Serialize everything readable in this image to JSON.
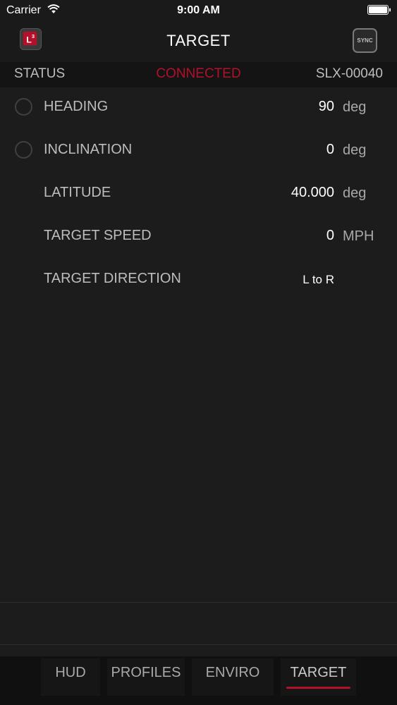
{
  "status_bar": {
    "carrier": "Carrier",
    "time": "9:00 AM",
    "wifi_icon": "wifi-icon",
    "battery_icon": "battery-icon"
  },
  "nav": {
    "title": "TARGET",
    "logo_icon": "l3-logo-icon",
    "sync_label": "SYNC"
  },
  "status": {
    "label": "STATUS",
    "value": "CONNECTED",
    "value_color": "#b3102a",
    "device_id": "SLX-00040"
  },
  "rows": [
    {
      "label": "HEADING",
      "value": "90",
      "unit": "deg",
      "has_radio": true
    },
    {
      "label": "INCLINATION",
      "value": "0",
      "unit": "deg",
      "has_radio": true
    },
    {
      "label": "LATITUDE",
      "value": "40.000",
      "unit": "deg",
      "has_radio": false
    },
    {
      "label": "TARGET SPEED",
      "value": "0",
      "unit": "MPH",
      "has_radio": false
    },
    {
      "label": "TARGET DIRECTION",
      "value": "L to R",
      "unit": "",
      "has_radio": false
    }
  ],
  "tabs": [
    {
      "label": "HUD",
      "active": false
    },
    {
      "label": "PROFILES",
      "active": false
    },
    {
      "label": "ENVIRO",
      "active": false
    },
    {
      "label": "TARGET",
      "active": true
    }
  ],
  "accent_color": "#b3102a"
}
